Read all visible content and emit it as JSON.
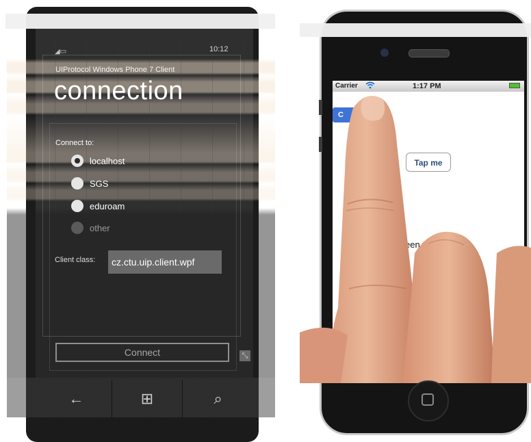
{
  "windows_phone": {
    "status_time": "10:12",
    "app_title": "UIProtocol Windows Phone 7 Client",
    "page_title": "connection",
    "connect_to_label": "Connect to:",
    "radio_options": [
      {
        "label": "localhost",
        "selected": true
      },
      {
        "label": "SGS",
        "selected": false
      },
      {
        "label": "eduroam",
        "selected": false
      },
      {
        "label": "other",
        "selected": false
      }
    ],
    "client_class_label": "Client class:",
    "client_class_value": "cz.ctu.uip.client.wpf",
    "connect_button": "Connect",
    "nav": {
      "back_icon": "←",
      "windows_icon": "⊞",
      "search_icon": "⌕"
    }
  },
  "iphone": {
    "status": {
      "carrier": "Carrier",
      "wifi_icon": "wifi-icon",
      "time": "1:17 PM"
    },
    "nav_button_label": "C",
    "tap_button": "Tap me",
    "screen_text": "een to"
  }
}
